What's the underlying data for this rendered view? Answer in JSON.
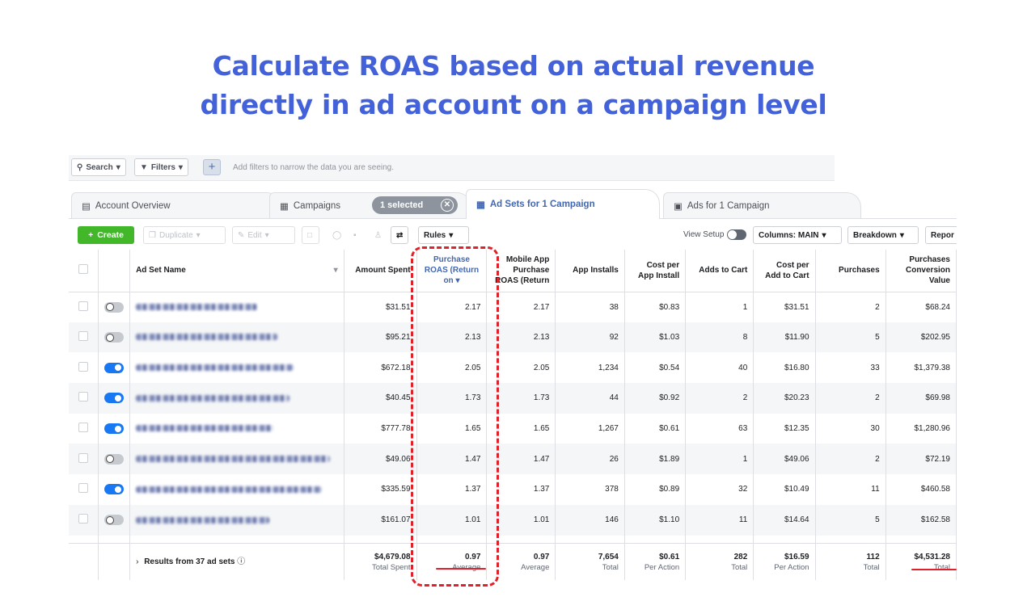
{
  "headline": {
    "line1": "Calculate ROAS based on actual revenue",
    "line2": "directly in ad account on a campaign level"
  },
  "searchbar": {
    "search_label": "Search",
    "filters_label": "Filters",
    "add_label": "+",
    "hint": "Add filters to narrow the data you are seeing."
  },
  "tabs": {
    "account_overview": "Account Overview",
    "campaigns": "Campaigns",
    "selected": "1 selected",
    "adsets": "Ad Sets for 1 Campaign",
    "ads": "Ads for 1 Campaign"
  },
  "toolbar": {
    "create": "Create",
    "duplicate": "Duplicate",
    "edit": "Edit",
    "rules": "Rules",
    "view_setup": "View Setup",
    "columns": "Columns: MAIN",
    "breakdown": "Breakdown",
    "reports": "Repor"
  },
  "columns": {
    "name": "Ad Set Name",
    "amount": "Amount Spent",
    "roas": "Purchase ROAS (Return on",
    "mobile": "Mobile App Purchase ROAS (Return",
    "installs": "App Installs",
    "cpi": "Cost per App Install",
    "atc": "Adds to Cart",
    "cpatc": "Cost per Add to Cart",
    "purchases": "Purchases",
    "pcv": "Purchases Conversion Value"
  },
  "rows": [
    {
      "on": false,
      "amount": "$31.51",
      "roas": "2.17",
      "mobile": "2.17",
      "installs": "38",
      "cpi": "$0.83",
      "atc": "1",
      "cpatc": "$31.51",
      "purchases": "2",
      "pcv": "$68.24"
    },
    {
      "on": false,
      "amount": "$95.21",
      "roas": "2.13",
      "mobile": "2.13",
      "installs": "92",
      "cpi": "$1.03",
      "atc": "8",
      "cpatc": "$11.90",
      "purchases": "5",
      "pcv": "$202.95"
    },
    {
      "on": true,
      "amount": "$672.18",
      "roas": "2.05",
      "mobile": "2.05",
      "installs": "1,234",
      "cpi": "$0.54",
      "atc": "40",
      "cpatc": "$16.80",
      "purchases": "33",
      "pcv": "$1,379.38"
    },
    {
      "on": true,
      "amount": "$40.45",
      "roas": "1.73",
      "mobile": "1.73",
      "installs": "44",
      "cpi": "$0.92",
      "atc": "2",
      "cpatc": "$20.23",
      "purchases": "2",
      "pcv": "$69.98"
    },
    {
      "on": true,
      "amount": "$777.78",
      "roas": "1.65",
      "mobile": "1.65",
      "installs": "1,267",
      "cpi": "$0.61",
      "atc": "63",
      "cpatc": "$12.35",
      "purchases": "30",
      "pcv": "$1,280.96"
    },
    {
      "on": false,
      "amount": "$49.06",
      "roas": "1.47",
      "mobile": "1.47",
      "installs": "26",
      "cpi": "$1.89",
      "atc": "1",
      "cpatc": "$49.06",
      "purchases": "2",
      "pcv": "$72.19"
    },
    {
      "on": true,
      "amount": "$335.59",
      "roas": "1.37",
      "mobile": "1.37",
      "installs": "378",
      "cpi": "$0.89",
      "atc": "32",
      "cpatc": "$10.49",
      "purchases": "11",
      "pcv": "$460.58"
    },
    {
      "on": false,
      "amount": "$161.07",
      "roas": "1.01",
      "mobile": "1.01",
      "installs": "146",
      "cpi": "$1.10",
      "atc": "11",
      "cpatc": "$14.64",
      "purchases": "5",
      "pcv": "$162.58"
    }
  ],
  "totals": {
    "results": "Results from 37 ad sets",
    "amount": "$4,679.08",
    "amount_label": "Total Spent",
    "roas": "0.97",
    "roas_label": "Average",
    "mobile": "0.97",
    "mobile_label": "Average",
    "installs": "7,654",
    "installs_label": "Total",
    "cpi": "$0.61",
    "cpi_label": "Per Action",
    "atc": "282",
    "atc_label": "Total",
    "cpatc": "$16.59",
    "cpatc_label": "Per Action",
    "purchases": "112",
    "purchases_label": "Total",
    "pcv": "$4,531.28",
    "pcv_label": "Total"
  },
  "colors": {
    "headline": "#4361d8",
    "highlight": "#e0212a",
    "toggle_on": "#1877f2",
    "create": "#42b72a"
  }
}
